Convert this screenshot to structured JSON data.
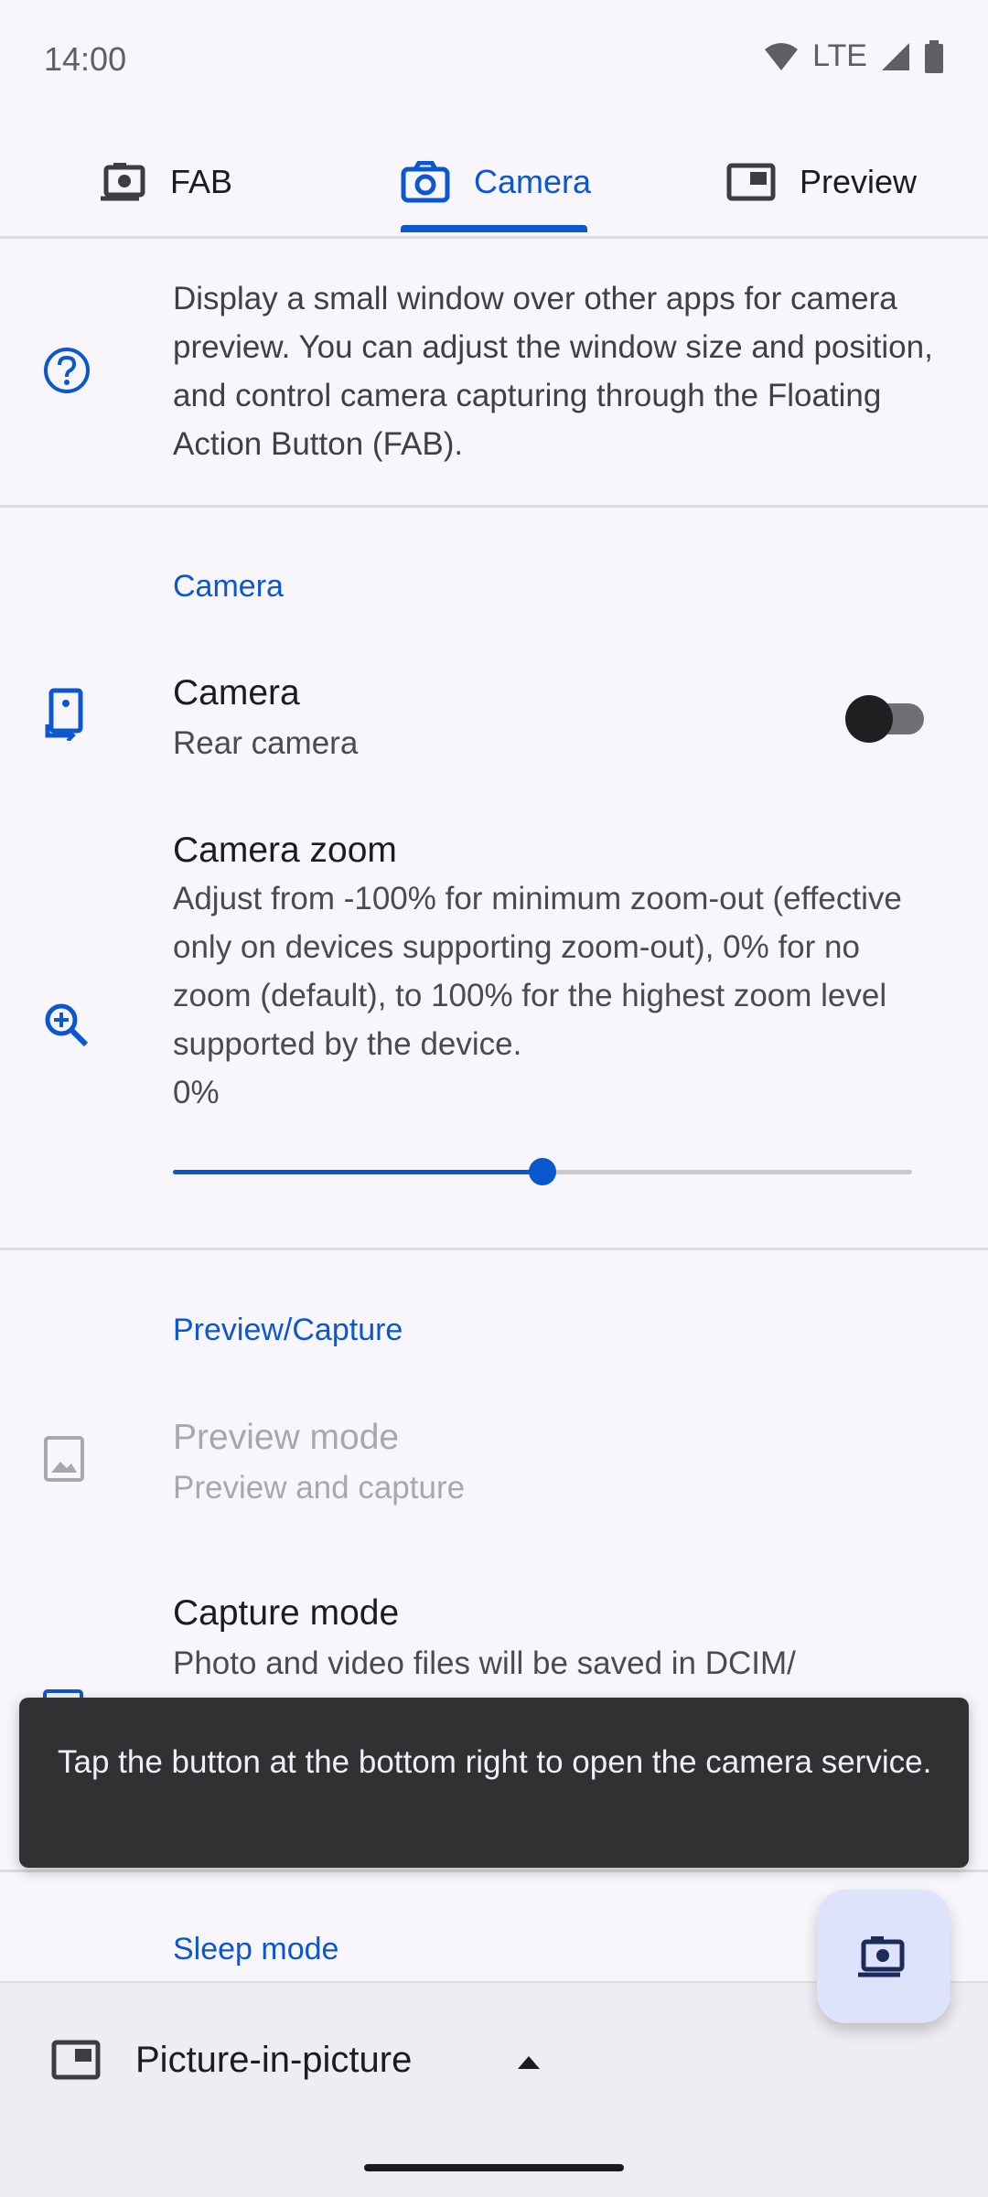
{
  "status_bar": {
    "time": "14:00",
    "network": "LTE"
  },
  "tabs": [
    {
      "label": "FAB",
      "icon": "camera-fab-icon",
      "active": false
    },
    {
      "label": "Camera",
      "icon": "camera-icon",
      "active": true
    },
    {
      "label": "Preview",
      "icon": "preview-window-icon",
      "active": false
    }
  ],
  "intro": {
    "icon": "help-icon",
    "text": "Display a small window over other apps for camera preview. You can adjust the window size and position, and control camera capturing through the Floating Action Button (FAB)."
  },
  "camera_section": {
    "title": "Camera",
    "camera_setting": {
      "title": "Camera",
      "subtitle": "Rear camera",
      "icon": "camera-switch-icon",
      "toggle_on": false
    },
    "zoom_setting": {
      "title": "Camera zoom",
      "description": "Adjust from -100% for minimum zoom-out (effective only on devices supporting zoom-out), 0% for no zoom (default), to 100% for the highest zoom level supported by the device.",
      "value": "0%",
      "slider_fraction": 0.5,
      "icon": "zoom-in-icon"
    }
  },
  "preview_capture_section": {
    "title": "Preview/Capture",
    "preview_mode": {
      "title": "Preview mode",
      "subtitle": "Preview and capture",
      "icon": "image-icon",
      "enabled": false
    },
    "capture_mode": {
      "title": "Capture mode",
      "subtitle": "Photo and video files will be saved in DCIM/",
      "icon": "capture-icon"
    }
  },
  "sleep_section": {
    "title": "Sleep mode"
  },
  "snackbar": {
    "text": "Tap the button at the bottom right to open the camera service."
  },
  "bottom_bar": {
    "title": "Picture-in-picture",
    "icon": "picture-in-picture-icon"
  },
  "fab": {
    "icon": "camera-fab-icon"
  },
  "colors": {
    "accent": "#0b57d0",
    "background": "#f8f6fb",
    "snackbar": "#313033",
    "fab_bg": "#dde3fb"
  }
}
